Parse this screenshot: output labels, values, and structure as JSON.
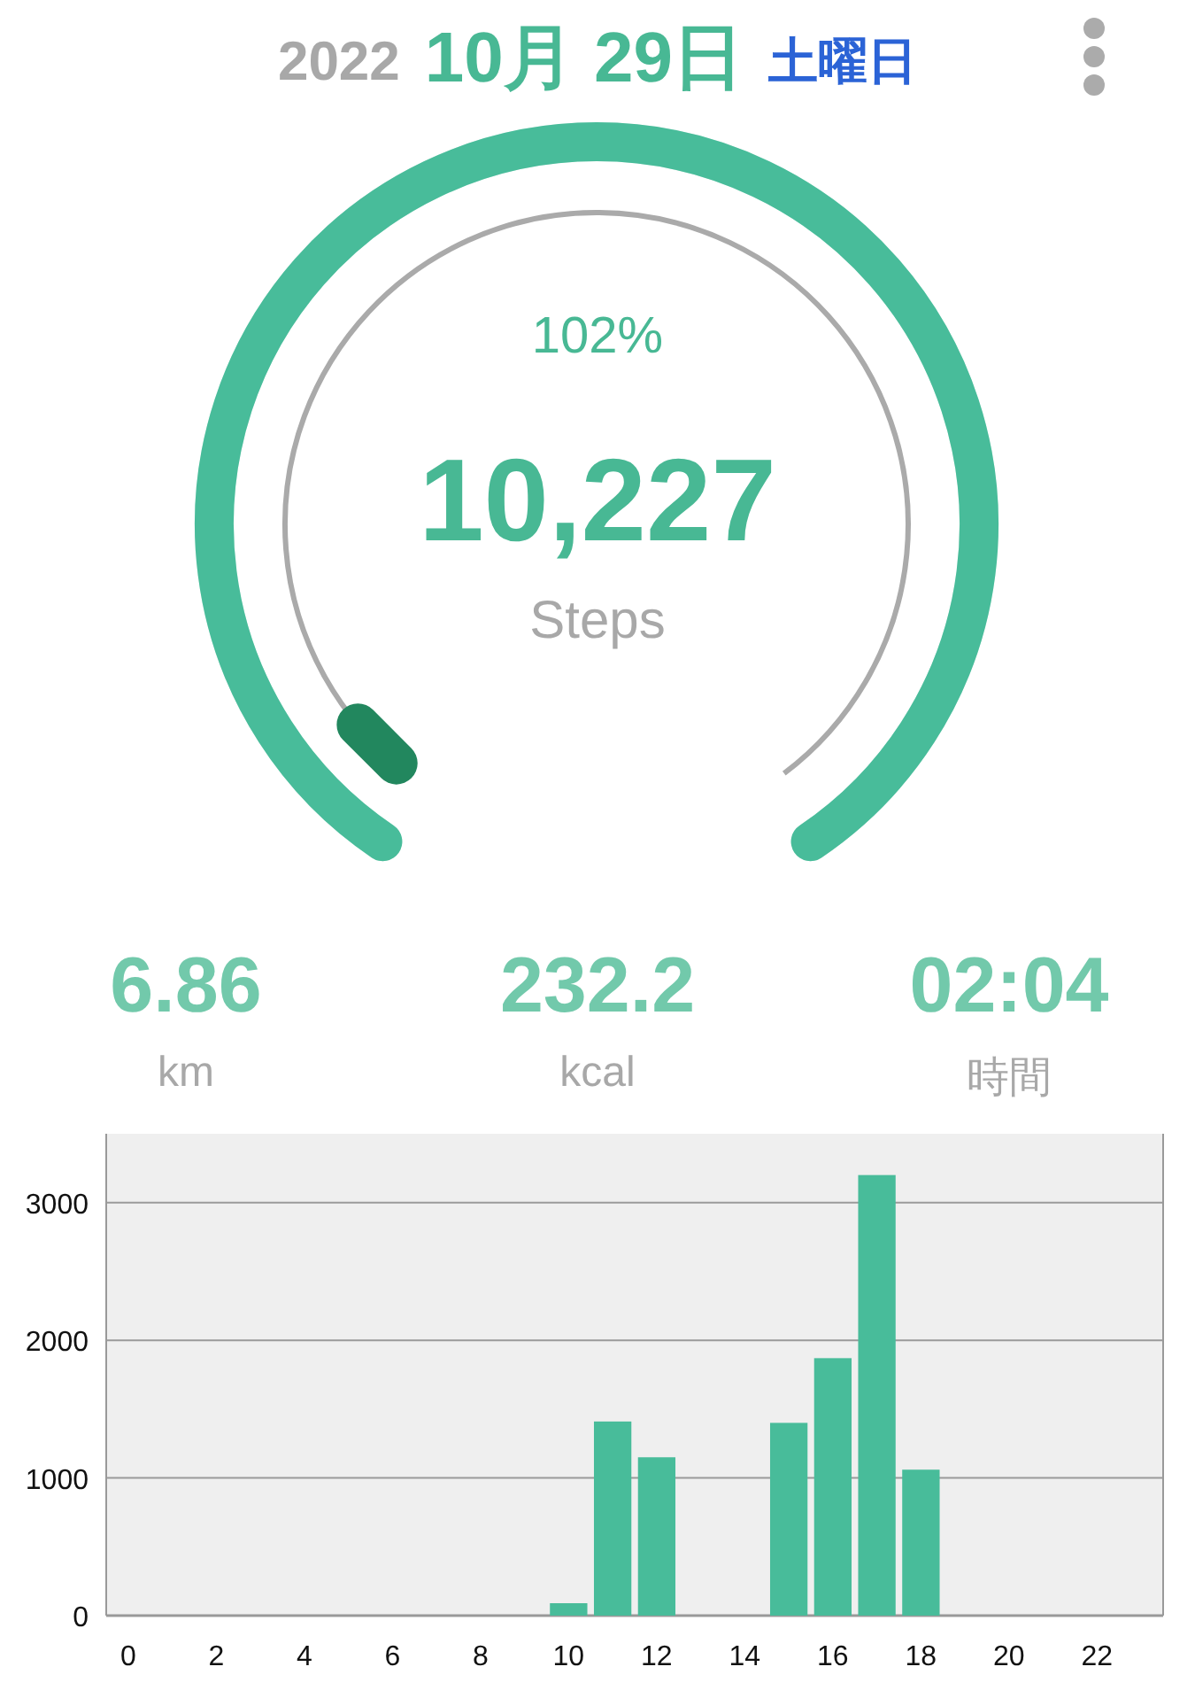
{
  "header": {
    "year": "2022",
    "date": "10月 29日",
    "weekday": "土曜日"
  },
  "gauge": {
    "percent": "102%",
    "steps": "10,227",
    "unit": "Steps",
    "level": 1
  },
  "stats": [
    {
      "value": "6.86",
      "label": "km"
    },
    {
      "value": "232.2",
      "label": "kcal"
    },
    {
      "value": "02:04",
      "label": "時間"
    }
  ],
  "chart": {
    "chart_data": {
      "type": "bar",
      "x": [
        0,
        1,
        2,
        3,
        4,
        5,
        6,
        7,
        8,
        9,
        10,
        11,
        12,
        13,
        14,
        15,
        16,
        17,
        18,
        19,
        20,
        21,
        22,
        23
      ],
      "values": [
        0,
        0,
        0,
        0,
        0,
        0,
        0,
        0,
        0,
        0,
        90,
        1410,
        1150,
        0,
        0,
        1400,
        1870,
        3200,
        1060,
        0,
        0,
        0,
        0,
        0
      ],
      "color": "#48bc9a",
      "grid": true,
      "xlim": [
        -0.5,
        23.5
      ],
      "ylim": [
        0,
        3500
      ],
      "xticks": [
        0,
        2,
        4,
        6,
        8,
        10,
        12,
        14,
        16,
        18,
        20,
        22
      ],
      "yticks": [
        0,
        1000,
        2000,
        3000
      ]
    }
  }
}
